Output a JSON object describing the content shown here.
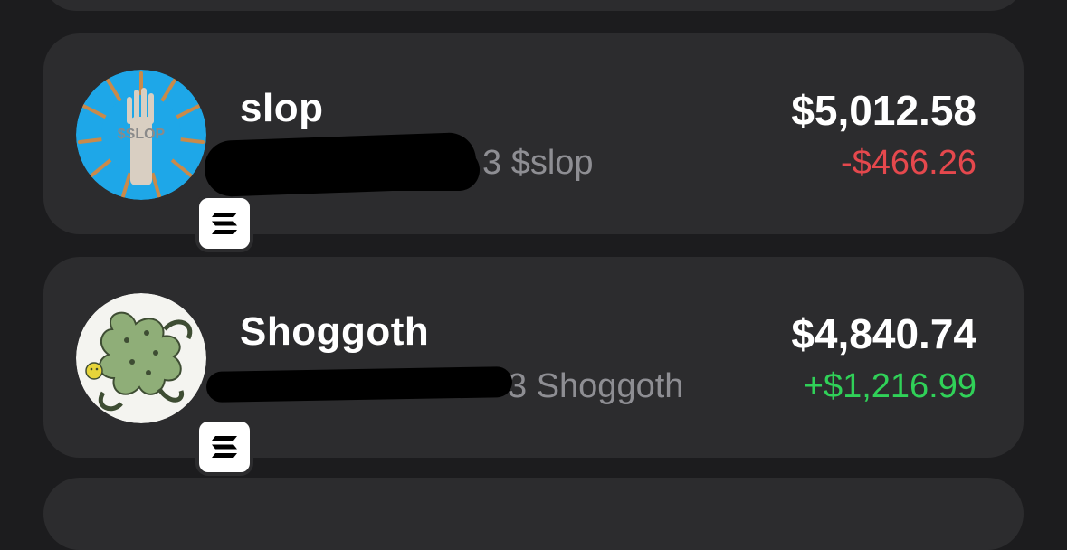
{
  "assets": [
    {
      "name": "slop",
      "quantity_suffix": "3 $slop",
      "value": "$5,012.58",
      "change": "-$466.26",
      "change_color": "#e5484d",
      "logo_text": "$SLOP",
      "chain_icon": "solana-icon"
    },
    {
      "name": "Shoggoth",
      "quantity_suffix": "3 Shoggoth",
      "value": "$4,840.74",
      "change": "+$1,216.99",
      "change_color": "#30d158",
      "chain_icon": "solana-icon"
    }
  ],
  "colors": {
    "background": "#1c1c1e",
    "card": "#2c2c2e",
    "primary_text": "#ffffff",
    "secondary_text": "#8e8e93",
    "negative": "#e5484d",
    "positive": "#30d158"
  }
}
